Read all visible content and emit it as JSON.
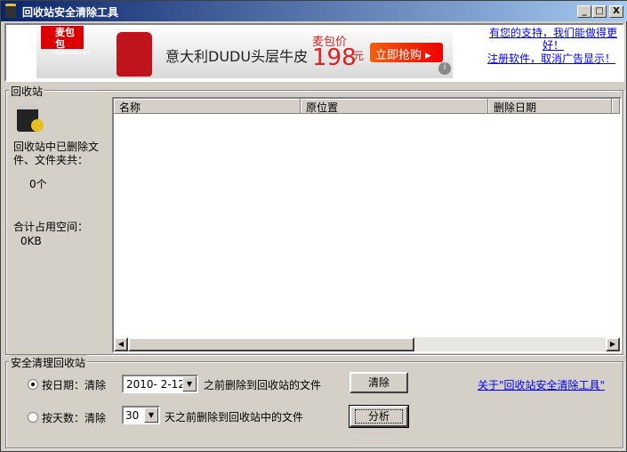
{
  "window": {
    "title": "回收站安全清除工具",
    "min": "_",
    "max": "□",
    "close": "X"
  },
  "ad": {
    "brand": "麦包包",
    "brand_sub": "Mbaobao.com",
    "product": "意大利DUDU头层牛皮",
    "price_label": "麦包价",
    "price": "198",
    "currency": "元",
    "cta": "立即抢购 ▸",
    "info": "i"
  },
  "links": {
    "support": "有您的支持，我们能做得更好！",
    "register": "注册软件，取消广告显示！",
    "about": "关于\"回收站安全清除工具\""
  },
  "recycle": {
    "group_label": "回收站",
    "deleted_label": "回收站中已删除文件、文件夹共：",
    "count": "0个",
    "space_label": "合计占用空间：",
    "space": "0KB"
  },
  "table": {
    "columns": [
      "名称",
      "原位置",
      "删除日期"
    ],
    "rows": []
  },
  "clean": {
    "group_label": "安全清理回收站",
    "by_date": "按日期：清除",
    "date_value": "2010- 2-12",
    "date_suffix": "之前删除到回收站的文件",
    "by_days": "按天数：清除",
    "days_value": "30",
    "days_suffix": "天之前删除到回收站中的文件",
    "clear_button": "清除",
    "analyze_button": "分析"
  }
}
